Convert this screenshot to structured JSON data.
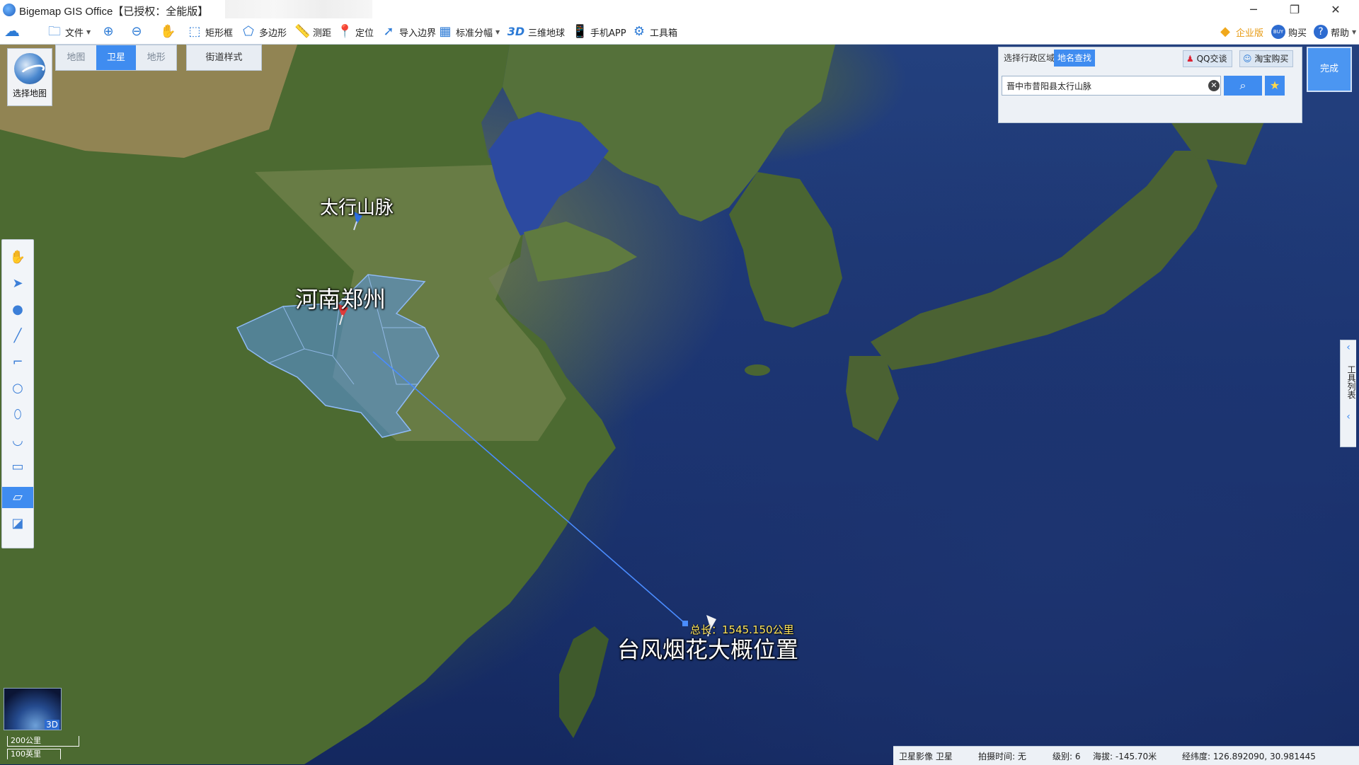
{
  "app": {
    "title": "Bigemap GIS Office【已授权：全能版】",
    "window_controls": {
      "minimize": "─",
      "maximize": "❐",
      "close": "✕"
    }
  },
  "toolbar": {
    "items": [
      {
        "label": "文件",
        "icon": "folder-icon"
      },
      {
        "label": "",
        "icon": "zoom-in-icon"
      },
      {
        "label": "",
        "icon": "zoom-out-icon"
      },
      {
        "label": "",
        "icon": "pan-hand-icon"
      },
      {
        "label": "矩形框",
        "icon": "rectangle-select-icon"
      },
      {
        "label": "多边形",
        "icon": "polygon-select-icon"
      },
      {
        "label": "测距",
        "icon": "ruler-icon"
      },
      {
        "label": "定位",
        "icon": "location-pin-icon"
      },
      {
        "label": "导入边界",
        "icon": "import-boundary-icon"
      },
      {
        "label": "标准分幅",
        "icon": "grid-icon"
      },
      {
        "label": "三维地球",
        "icon": "3d-globe-icon",
        "badge": "3D"
      },
      {
        "label": "手机APP",
        "icon": "mobile-app-icon"
      },
      {
        "label": "工具箱",
        "icon": "gear-toolbox-icon"
      }
    ],
    "right": {
      "enterprise": "企业版",
      "buy": "购买",
      "help": "帮助",
      "buy_badge": "BUY"
    }
  },
  "map_controls": {
    "select_map_label": "选择地图",
    "map_types": [
      "地图",
      "卫星",
      "地形"
    ],
    "active_map_type": "卫星",
    "street_style": "街道样式"
  },
  "search_panel": {
    "tabs": [
      "选择行政区域",
      "地名查找"
    ],
    "active_tab": "地名查找",
    "qq_button": "QQ交谈",
    "taobao_button": "淘宝购买",
    "query": "晋中市昔阳县太行山脉",
    "done_label": "完成"
  },
  "right_tools_label": "工具列表",
  "map_labels": {
    "taihang": "太行山脉",
    "henan": "河南郑州",
    "typhoon": "台风烟花大概位置",
    "measure_total": "总长：1545.150公里"
  },
  "minimap_badge": "3D",
  "scale": {
    "metric": "200公里",
    "imperial": "100英里"
  },
  "status": {
    "layer": "卫星影像 卫星",
    "capture_time": "拍摄时间: 无",
    "level": "级别: 6",
    "altitude": "海拔: -145.70米",
    "coords": "经纬度: 126.892090, 30.981445"
  },
  "colors": {
    "accent": "#3f8cf0",
    "region_fill": "#5a96e6",
    "measure_line": "#4a8cff",
    "measure_text": "#ffe55a"
  }
}
